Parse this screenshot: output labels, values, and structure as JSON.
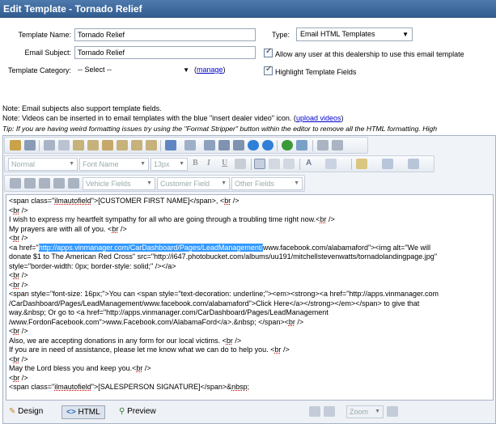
{
  "window": {
    "title": "Edit Template - Tornado Relief"
  },
  "form": {
    "template_name_label": "Template Name:",
    "template_name_value": "Tornado Relief",
    "email_subject_label": "Email Subject:",
    "email_subject_value": "Tornado Relief",
    "template_category_label": "Template Category:",
    "template_category_value": "-- Select --",
    "manage_link": "manage",
    "manage_paren_open": "(",
    "manage_paren_close": ")",
    "type_label": "Type:",
    "type_value": "Email HTML Templates",
    "allow_any_user_label": "Allow any user at this dealership to use this email template",
    "allow_any_user_checked": true,
    "highlight_fields_label": "Highlight Template Fields",
    "highlight_fields_checked": true
  },
  "notes": {
    "note1": "Note: Email subjects also support template fields.",
    "note2_prefix": "Note: Videos can be inserted in to email templates with the blue \"insert dealer video\" icon. (",
    "note2_link": "upload videos",
    "note2_suffix": ")",
    "tip": "Tip: If you are having weird formatting issues try using the \"Format Stripper\" button within the editor to remove all the HTML formatting. High"
  },
  "toolbar": {
    "format_dropdown": "Normal",
    "font_dropdown": "Font Name",
    "size_dropdown": "13px",
    "vehicle_fields": "Vehicle Fields",
    "customer_field": "Customer Field",
    "other_fields": "Other Fields",
    "zoom": "Zoom",
    "colors": {
      "accent": "#3d6aa0",
      "blue_icon": "#2f7fd6",
      "green_icon": "#3a9a3a"
    }
  },
  "code_lines": [
    [
      {
        "t": "<span class=\""
      },
      {
        "t": "ilmautofield",
        "u": 1
      },
      {
        "t": "\">[CUSTOMER FIRST NAME]</span>, <"
      },
      {
        "t": "br",
        "u": 1
      },
      {
        "t": " />"
      }
    ],
    [
      {
        "t": "<"
      },
      {
        "t": "br",
        "u": 1
      },
      {
        "t": " />"
      }
    ],
    [
      {
        "t": "I wish to express my heartfelt sympathy for all who are going through a troubling time right now.<"
      },
      {
        "t": "br",
        "u": 1
      },
      {
        "t": " />"
      }
    ],
    [
      {
        "t": "My prayers are with all of you. <"
      },
      {
        "t": "br",
        "u": 1
      },
      {
        "t": " />"
      }
    ],
    [
      {
        "t": "<"
      },
      {
        "t": "br",
        "u": 1
      },
      {
        "t": " />"
      }
    ],
    [
      {
        "t": "<a href=\""
      },
      {
        "t": "http://apps.vinmanager.com/CarDashboard/Pages/LeadManagement/",
        "h": 1
      },
      {
        "t": "www.facebook.com/alabamaford\"><img alt=\"We will"
      }
    ],
    [
      {
        "t": "donate $1 to The American Red Cross\" src=\"http://i647.photobucket.com/albums/uu191/mitchellstevenwatts/tornadolandingpage.jpg\""
      }
    ],
    [
      {
        "t": "style=\"border-width: 0px; border-style: solid;\" /></a>"
      }
    ],
    [
      {
        "t": "<"
      },
      {
        "t": "br",
        "u": 1
      },
      {
        "t": " />"
      }
    ],
    [
      {
        "t": "<"
      },
      {
        "t": "br",
        "u": 1
      },
      {
        "t": " />"
      }
    ],
    [
      {
        "t": "<span style=\"font-size: 16px;\">You can <span style=\"text-decoration: underline;\"><em><strong><a href=\"http://apps.vinmanager.com"
      }
    ],
    [
      {
        "t": "/CarDashboard/Pages/LeadManagement/www.facebook.com/alabamaford\">Click Here</a></strong></em></span> to give that"
      }
    ],
    [
      {
        "t": "way.&nbsp; Or go to <a href=\"http://apps.vinmanager.com/CarDashboard/Pages/LeadManagement"
      }
    ],
    [
      {
        "t": "/www.FordonFacebook.com\">www.Facebook.com/AlabamaFord</a>.&nbsp; </span><"
      },
      {
        "t": "br",
        "u": 1
      },
      {
        "t": " />"
      }
    ],
    [
      {
        "t": "<"
      },
      {
        "t": "br",
        "u": 1
      },
      {
        "t": " />"
      }
    ],
    [
      {
        "t": "Also, we are accepting donations in any form for our local victims. <"
      },
      {
        "t": "br",
        "u": 1
      },
      {
        "t": " />"
      }
    ],
    [
      {
        "t": "If you are in need of assistance, please let me know what we can do to help you. <"
      },
      {
        "t": "br",
        "u": 1
      },
      {
        "t": " />"
      }
    ],
    [
      {
        "t": "<"
      },
      {
        "t": "br",
        "u": 1
      },
      {
        "t": " />"
      }
    ],
    [
      {
        "t": "May the Lord bless you and keep you.<"
      },
      {
        "t": "br",
        "u": 1
      },
      {
        "t": " />"
      }
    ],
    [
      {
        "t": "<"
      },
      {
        "t": "br",
        "u": 1
      },
      {
        "t": " />"
      }
    ],
    [
      {
        "t": "<span class=\""
      },
      {
        "t": "ilmautofield",
        "u": 1
      },
      {
        "t": "\">[SALESPERSON SIGNATURE]</span>&"
      },
      {
        "t": "nbsp",
        "u": 1
      },
      {
        "t": ";"
      }
    ]
  ],
  "modes": {
    "design": "Design",
    "html": "HTML",
    "preview": "Preview",
    "active": "HTML"
  }
}
